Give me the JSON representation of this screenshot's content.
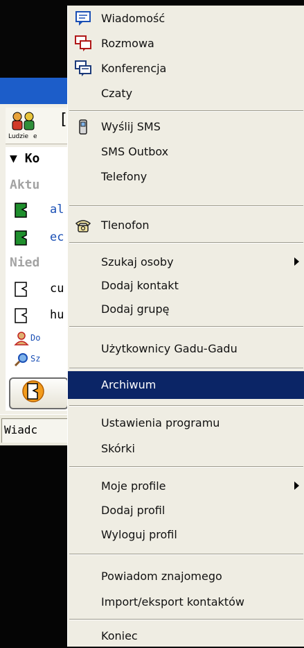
{
  "app": {
    "people_label": "Ludzie",
    "people_label_2": "e",
    "toolbar_bracket": "[",
    "groups": [
      {
        "title": "Ko",
        "expanded": true
      },
      {
        "title": "Aktu"
      },
      {
        "title": "Nied"
      }
    ],
    "contacts": [
      {
        "name": "al",
        "status": "online"
      },
      {
        "name": "ec",
        "status": "online"
      },
      {
        "name": "cu",
        "status": "offline"
      },
      {
        "name": "hu",
        "status": "offline"
      }
    ],
    "links": [
      {
        "label": "Do",
        "icon": "add-person-icon"
      },
      {
        "label": "Sz",
        "icon": "search-icon"
      }
    ],
    "tab_label": "Wiadc",
    "colors": {
      "titlebar": "#1c5dc9",
      "online": "#1f8f2d",
      "link": "#1a4fb5"
    }
  },
  "menu": {
    "items": [
      {
        "label": "Wiadomość",
        "icon": "message-icon"
      },
      {
        "label": "Rozmowa",
        "icon": "chat-icon"
      },
      {
        "label": "Konferencja",
        "icon": "conference-icon"
      },
      {
        "label": "Czaty"
      },
      {
        "label": "Wyślij SMS",
        "icon": "phone-icon"
      },
      {
        "label": "SMS Outbox"
      },
      {
        "label": "Telefony"
      },
      {
        "label": "Tlenofon",
        "icon": "telephone-icon"
      },
      {
        "label": "Szukaj osoby",
        "submenu": true
      },
      {
        "label": "Dodaj kontakt"
      },
      {
        "label": "Dodaj grupę"
      },
      {
        "label": "Użytkownicy Gadu-Gadu"
      },
      {
        "label": "Archiwum",
        "highlighted": true
      },
      {
        "label": "Ustawienia programu"
      },
      {
        "label": "Skórki"
      },
      {
        "label": "Moje profile",
        "submenu": true
      },
      {
        "label": "Dodaj profil"
      },
      {
        "label": "Wyloguj profil"
      },
      {
        "label": "Powiadom znajomego"
      },
      {
        "label": "Import/eksport kontaktów"
      },
      {
        "label": "Koniec"
      }
    ],
    "colors": {
      "background": "#efede3",
      "highlight": "#0b2566",
      "highlight_text": "#ffffff"
    }
  }
}
